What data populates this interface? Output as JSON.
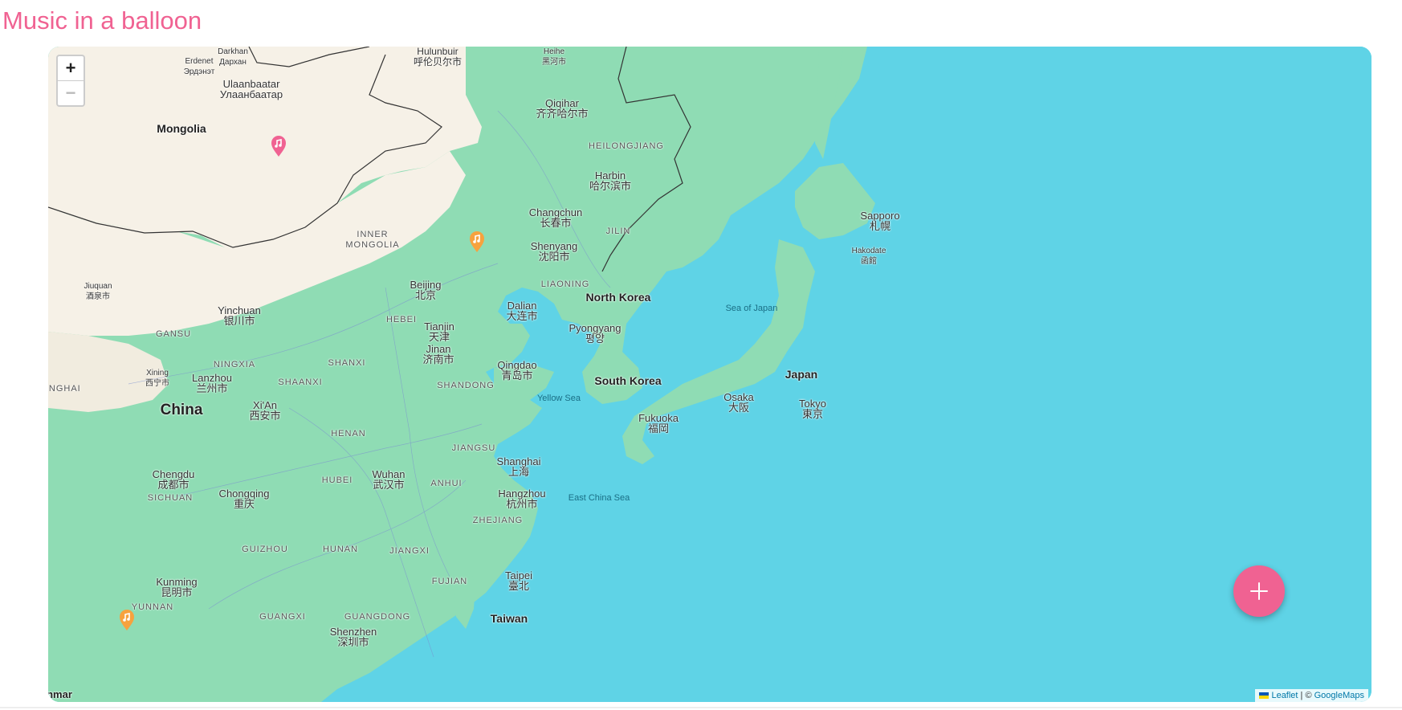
{
  "app": {
    "title": "Music in a balloon"
  },
  "zoom": {
    "in": "+",
    "out": "−"
  },
  "attribution": {
    "leaflet": "Leaflet",
    "separator": " | © ",
    "provider": "GoogleMaps"
  },
  "colors": {
    "accent": "#f06292",
    "marker_orange": "#f7a23e",
    "sea": "#5fd3e6",
    "land": "#f6f1e7",
    "forest": "#8fdcb4"
  },
  "map_labels": {
    "hulunbuir": "Hulunbuir\n呼伦贝尔市",
    "heihe": "Heihe\n黑河市",
    "darkhan": "Darkhan\nДархан",
    "erdenet": "Erdenet\nЭрдэнэт",
    "ulaanbaatar": "Ulaanbaatar\nУлаанбаатар",
    "mongolia": "Mongolia",
    "qiqihar": "Qiqihar\n齐齐哈尔市",
    "heilongjiang": "HEILONGJIANG",
    "harbin": "Harbin\n哈尔滨市",
    "changchun": "Changchun\n长春市",
    "jilin": "JILIN",
    "inner_mongolia": "INNER\nMONGOLIA",
    "shenyang": "Shenyang\n沈阳市",
    "liaoning": "LIAONING",
    "sapporo": "Sapporo\n札幌",
    "hakodate": "Hakodate\n函館",
    "jiuquan": "Jiuquan\n酒泉市",
    "beijing": "Beijing\n北京",
    "dalian": "Dalian\n大连市",
    "north_korea": "North Korea",
    "sea_of_japan": "Sea of Japan",
    "yinchuan": "Yinchuan\n银川市",
    "gansu": "GANSU",
    "hebei": "HEBEI",
    "tianjin": "Tianjin\n天津",
    "pyongyang": "Pyongyang\n평양",
    "xining": "Xining\n西宁市",
    "ningxia": "NINGXIA",
    "shanxi": "SHANXI",
    "jinan": "Jinan\n济南市",
    "qingdao": "Qingdao\n青岛市",
    "lanzhou": "Lanzhou\n兰州市",
    "qinghai": "QINGHAI",
    "shaanxi": "SHAANXI",
    "shandong": "SHANDONG",
    "south_korea": "South Korea",
    "japan": "Japan",
    "yellow_sea": "Yellow Sea",
    "xian": "Xi'An\n西安市",
    "china": "China",
    "osaka": "Osaka\n大阪",
    "tokyo": "Tokyo\n東京",
    "fukuoka": "Fukuoka\n福岡",
    "henan": "HENAN",
    "jiangsu": "JIANGSU",
    "shanghai": "Shanghai\n上海",
    "chengdu": "Chengdu\n成都市",
    "wuhan": "Wuhan\n武汉市",
    "hubei": "HUBEI",
    "anhui": "ANHUI",
    "chongqing": "Chongqing\n重庆",
    "hangzhou": "Hangzhou\n杭州市",
    "sichuan": "SICHUAN",
    "east_china_sea": "East China Sea",
    "zhejiang": "ZHEJIANG",
    "guizhou": "GUIZHOU",
    "hunan": "HUNAN",
    "jiangxi": "JIANGXI",
    "fujian": "FUJIAN",
    "kunming": "Kunming\n昆明市",
    "taipei": "Taipei\n臺北",
    "yunnan": "YUNNAN",
    "guangxi": "GUANGXI",
    "guangdong": "GUANGDONG",
    "taiwan": "Taiwan",
    "shenzhen": "Shenzhen\n深圳市",
    "myanmar": "nmar"
  }
}
